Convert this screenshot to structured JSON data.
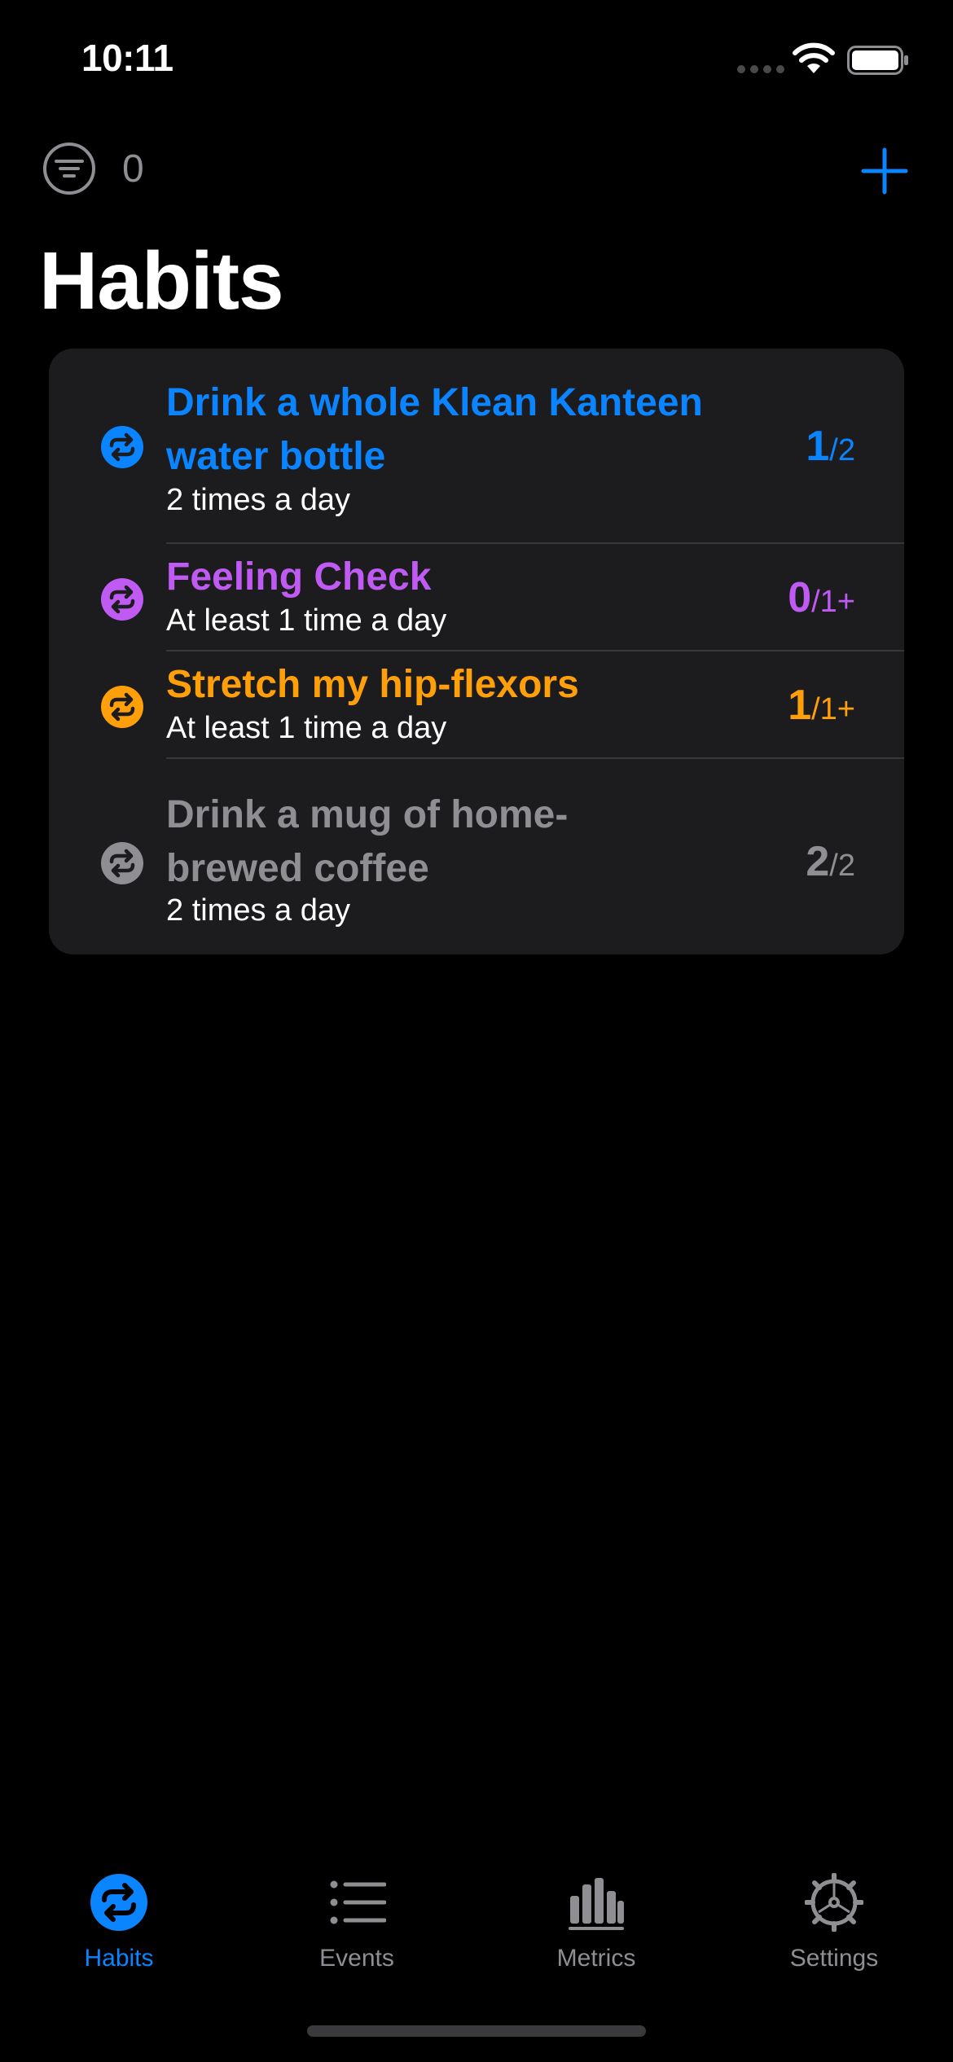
{
  "status_bar": {
    "time": "10:11"
  },
  "nav": {
    "filter_icon": "filter-circle-icon",
    "filter_count": "0",
    "add_icon": "plus-icon"
  },
  "page_title": "Habits",
  "colors": {
    "accent_blue": "#0a84ff",
    "purple": "#bf5af2",
    "orange": "#ff9f0a",
    "gray": "#8e8e93",
    "card_bg": "#1c1c1e"
  },
  "habits": [
    {
      "title": "Drink a whole Klean Kanteen water bottle",
      "subtitle": "2 times a day",
      "count_current": "1",
      "count_target": "/2",
      "color": "#0a84ff",
      "icon": "repeat-icon"
    },
    {
      "title": "Feeling Check",
      "subtitle": "At least 1 time a day",
      "count_current": "0",
      "count_target": "/1+",
      "color": "#bf5af2",
      "icon": "repeat-icon"
    },
    {
      "title": "Stretch my hip-flexors",
      "subtitle": "At least 1 time a day",
      "count_current": "1",
      "count_target": "/1+",
      "color": "#ff9f0a",
      "icon": "repeat-icon"
    },
    {
      "title": "Drink a mug of home-brewed coffee",
      "subtitle": "2 times a day",
      "count_current": "2",
      "count_target": "/2",
      "color": "#8e8e93",
      "icon": "repeat-icon"
    }
  ],
  "tabs": [
    {
      "label": "Habits",
      "icon": "repeat-circle-icon",
      "active": true
    },
    {
      "label": "Events",
      "icon": "list-icon",
      "active": false
    },
    {
      "label": "Metrics",
      "icon": "bar-chart-icon",
      "active": false
    },
    {
      "label": "Settings",
      "icon": "gear-icon",
      "active": false
    }
  ]
}
